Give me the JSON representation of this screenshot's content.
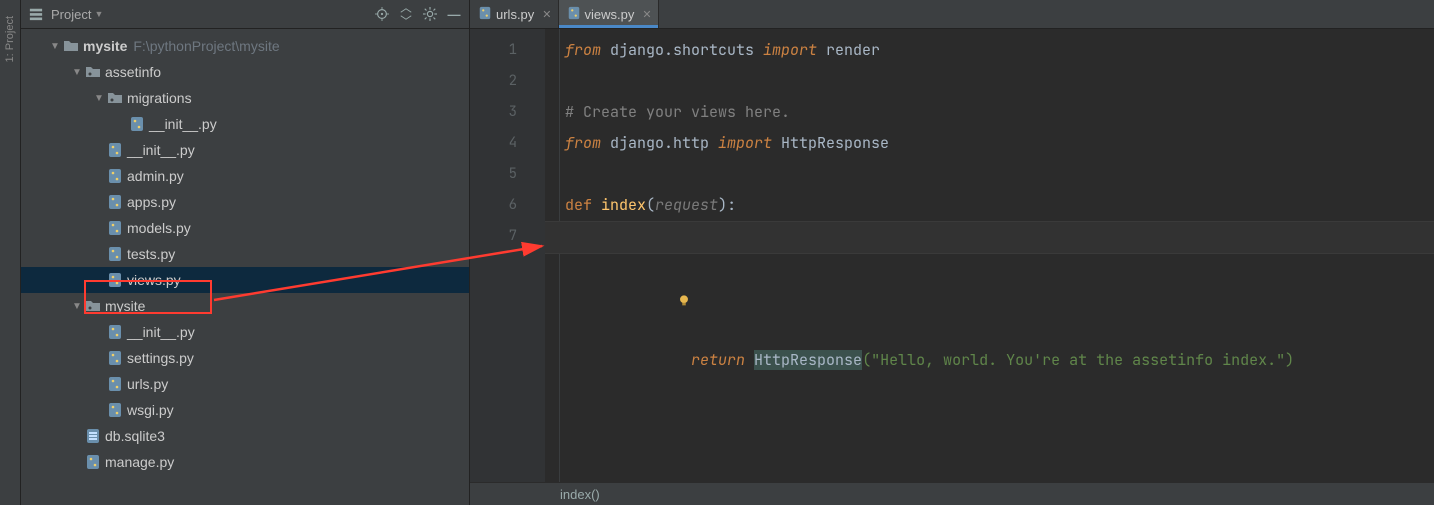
{
  "sidebar": {
    "title": "Project",
    "strip_label": "1: Project"
  },
  "tree": {
    "root_name": "mysite",
    "root_hint": "F:\\pythonProject\\mysite",
    "items": {
      "assetinfo": {
        "label": "assetinfo"
      },
      "migrations": {
        "label": "migrations"
      },
      "mig_init": {
        "label": "__init__.py"
      },
      "init": {
        "label": "__init__.py"
      },
      "admin": {
        "label": "admin.py"
      },
      "apps": {
        "label": "apps.py"
      },
      "models": {
        "label": "models.py"
      },
      "tests": {
        "label": "tests.py"
      },
      "views": {
        "label": "views.py"
      },
      "mysite_pkg": {
        "label": "mysite"
      },
      "ms_init": {
        "label": "__init__.py"
      },
      "settings": {
        "label": "settings.py"
      },
      "urls_pkg": {
        "label": "urls.py"
      },
      "wsgi": {
        "label": "wsgi.py"
      },
      "db": {
        "label": "db.sqlite3"
      },
      "manage": {
        "label": "manage.py"
      }
    }
  },
  "tabs": [
    {
      "label": "urls.py"
    },
    {
      "label": "views.py"
    }
  ],
  "editor": {
    "lines": [
      "1",
      "2",
      "3",
      "4",
      "5",
      "6",
      "7"
    ],
    "code": {
      "l1_from": "from",
      "l1_mod": " django.shortcuts ",
      "l1_import": "import",
      "l1_name": " render",
      "l3_comment": "# Create your views here.",
      "l4_from": "from",
      "l4_mod": " django.http ",
      "l4_import": "import",
      "l4_name": " HttpResponse",
      "l6_def": "def",
      "l6_fn": " index",
      "l6_open": "(",
      "l6_param": "request",
      "l6_close": "):",
      "l7_return": "    return",
      "l7_space": " ",
      "l7_http": "HttpResponse",
      "l7_arg": "(\"Hello, world. You're at the assetinfo index.\")"
    }
  },
  "footer": {
    "breadcrumb": "index()"
  }
}
